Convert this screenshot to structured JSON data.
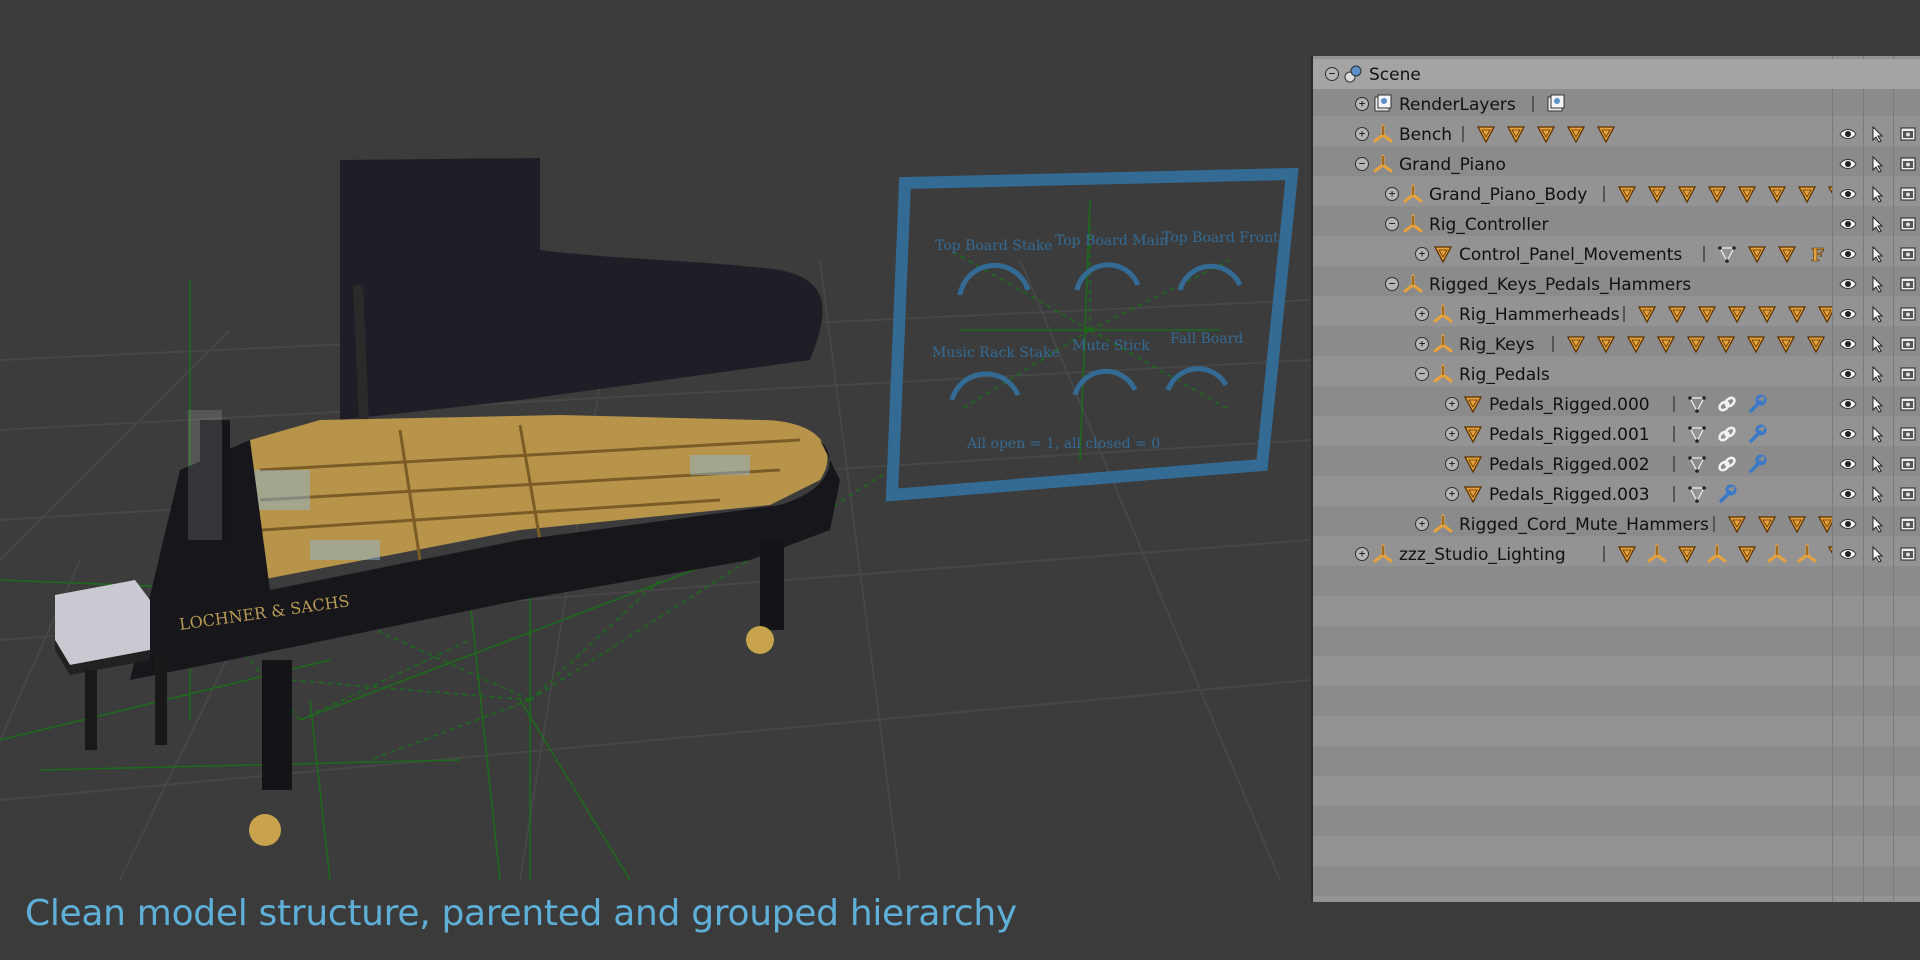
{
  "caption": "Clean model structure, parented and grouped hierarchy",
  "viewport": {
    "piano_brand": "LOCHNER & SACHS",
    "panel_labels": [
      "Top Board Stake",
      "Top Board Main",
      "Top Board Front",
      "Music Rack Stake",
      "Mute Stick",
      "Fall Board"
    ],
    "panel_note": "All open = 1, all closed = 0",
    "dial_zero": "0"
  },
  "outliner": {
    "rows": [
      {
        "label": "Scene",
        "depth": 0,
        "expand": "−",
        "icon": "scene-icon",
        "chips": [],
        "vis": false
      },
      {
        "label": "RenderLayers",
        "depth": 1,
        "expand": "+",
        "icon": "renderlayers-icon",
        "chips": [
          "renderlayer-chip-icon"
        ],
        "vis": false
      },
      {
        "label": "Bench",
        "depth": 1,
        "expand": "+",
        "icon": "empty-axis-icon",
        "chips": [
          "mesh-icon",
          "mesh-icon",
          "mesh-icon",
          "mesh-icon",
          "mesh-icon"
        ],
        "vis": true
      },
      {
        "label": "Grand_Piano",
        "depth": 1,
        "expand": "−",
        "icon": "empty-axis-icon",
        "chips": [],
        "vis": true
      },
      {
        "label": "Grand_Piano_Body",
        "depth": 2,
        "expand": "+",
        "icon": "empty-axis-icon",
        "chips": [
          "mesh-icon",
          "mesh-icon",
          "mesh-icon",
          "mesh-icon",
          "mesh-icon",
          "mesh-icon",
          "mesh-icon",
          "mesh-icon"
        ],
        "vis": true
      },
      {
        "label": "Rig_Controller",
        "depth": 2,
        "expand": "−",
        "icon": "empty-axis-icon",
        "chips": [],
        "vis": true
      },
      {
        "label": "Control_Panel_Movements",
        "depth": 3,
        "expand": "+",
        "icon": "mesh-icon",
        "chips": [
          "vertex-icon",
          "mesh-icon",
          "mesh-icon",
          "text-f-icon",
          "mesh-icon"
        ],
        "vis": true
      },
      {
        "label": "Rigged_Keys_Pedals_Hammers",
        "depth": 2,
        "expand": "−",
        "icon": "empty-axis-icon",
        "chips": [],
        "vis": true
      },
      {
        "label": "Rig_Hammerheads",
        "depth": 3,
        "expand": "+",
        "icon": "empty-axis-icon",
        "chips": [
          "mesh-icon",
          "mesh-icon",
          "mesh-icon",
          "mesh-icon",
          "mesh-icon",
          "mesh-icon",
          "mesh-icon"
        ],
        "vis": true
      },
      {
        "label": "Rig_Keys",
        "depth": 3,
        "expand": "+",
        "icon": "empty-axis-icon",
        "chips": [
          "mesh-icon",
          "mesh-icon",
          "mesh-icon",
          "mesh-icon",
          "mesh-icon",
          "mesh-icon",
          "mesh-icon",
          "mesh-icon",
          "mesh-icon"
        ],
        "vis": true
      },
      {
        "label": "Rig_Pedals",
        "depth": 3,
        "expand": "−",
        "icon": "empty-axis-icon",
        "chips": [],
        "vis": true
      },
      {
        "label": "Pedals_Rigged.000",
        "depth": 4,
        "expand": "+",
        "icon": "mesh-icon",
        "chips": [
          "vertex-icon",
          "constraint-link-icon",
          "wrench-icon"
        ],
        "vis": true
      },
      {
        "label": "Pedals_Rigged.001",
        "depth": 4,
        "expand": "+",
        "icon": "mesh-icon",
        "chips": [
          "vertex-icon",
          "constraint-link-icon",
          "wrench-icon"
        ],
        "vis": true
      },
      {
        "label": "Pedals_Rigged.002",
        "depth": 4,
        "expand": "+",
        "icon": "mesh-icon",
        "chips": [
          "vertex-icon",
          "constraint-link-icon",
          "wrench-icon"
        ],
        "vis": true
      },
      {
        "label": "Pedals_Rigged.003",
        "depth": 4,
        "expand": "+",
        "icon": "mesh-icon",
        "chips": [
          "vertex-icon",
          "wrench-icon"
        ],
        "vis": true
      },
      {
        "label": "Rigged_Cord_Mute_Hammers",
        "depth": 3,
        "expand": "+",
        "icon": "empty-axis-icon",
        "chips": [
          "mesh-icon",
          "mesh-icon",
          "mesh-icon",
          "mesh-icon"
        ],
        "vis": true
      },
      {
        "label": "zzz_Studio_Lighting",
        "depth": 1,
        "expand": "+",
        "icon": "empty-axis-icon",
        "chips": [
          "mesh-icon",
          "empty-axis-icon",
          "mesh-icon",
          "empty-axis-icon",
          "mesh-icon",
          "empty-axis-icon",
          "empty-axis-icon",
          "mesh-icon"
        ],
        "vis": true
      }
    ]
  }
}
